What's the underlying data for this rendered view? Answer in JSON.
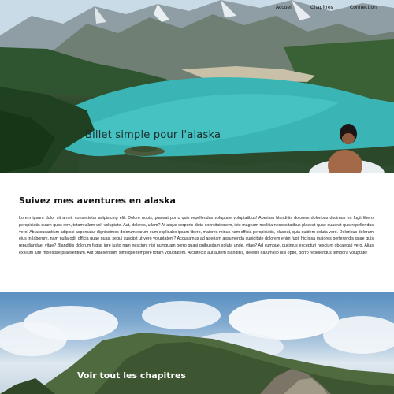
{
  "nav": {
    "items": [
      {
        "label": "Accueil"
      },
      {
        "label": "Chapitres"
      },
      {
        "label": "Connection"
      }
    ]
  },
  "hero": {
    "title": "Billet simple pour l'alaska"
  },
  "about": {
    "heading": "Suivez mes aventures en alaska",
    "body": "Lorem ipsum dolor sit amet, consectetur adipisicing elit. Dolore nobis, placeat porro quis repellendus voluptate voluptatibus! Aperiam blanditiis dolorem doloribus ducimus ea fugit libero perspiciatis quam quos rem, totam ullam vel, voluptate. Aut, dolores, ullam? At atque corporis dicta exercitationem, iste magnam mollitia necessitatibus placeat quae quaerat quis repellendus vero! Ab accusantium adipisci aspernatur dignissimos dolorum earum eum explicabo ipsam libero, maiores minus nam officia perspiciatis, placeat, quia quidem soluta vero. Doloribus dolorum eius in laborum, nam nulla odit officia quae quas, sequi suscipit ut vero voluptatem? Accusamus ad aperiam assumenda cupiditate dolorem enim fugit hic ipsa maiores perferendis quae quis repudiandae, vitae? Blanditiis dolorum fugiat iure iusto nam nesciunt nisi numquam porro quasi quibusdam soluta unde, vitae? Ad cumque, ducimus excepturi nesciunt obcaecati vero. Alias ex illum iure molestiae praesentium. Aut praesentium similique tempore totam voluptatem. Architecto aut autem blanditiis, deleniti harum illo nisi optio, porro repellendus tempora voluptate!"
  },
  "chapters": {
    "cta": "Voir tout les chapitres"
  }
}
